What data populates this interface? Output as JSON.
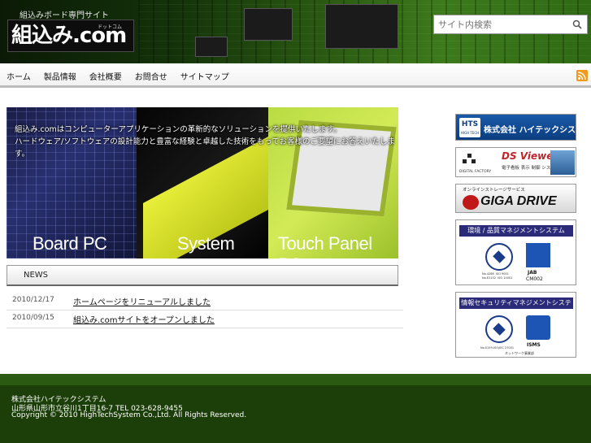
{
  "header": {
    "tagline": "組込みボード専門サイト",
    "logo_text": "組込み.com",
    "logo_ruby": "ドットコム"
  },
  "search": {
    "value": "",
    "placeholder": "サイト内検索"
  },
  "nav": {
    "items": [
      "ホーム",
      "製品情報",
      "会社概要",
      "お問合せ",
      "サイトマップ"
    ]
  },
  "hero": {
    "copy_line1": "組込み.comはコンピューターアプリケーションの革新的なソリューションを提供いたします。",
    "copy_line2": "ハードウェア/ソフトウェアの設計能力と豊富な経験と卓越した技術をもってお客様のご要望にお答えいたします。",
    "products": [
      "Board PC",
      "System",
      "Touch Panel PC"
    ]
  },
  "news": {
    "heading": "NEWS",
    "items": [
      {
        "date": "2010/12/17",
        "title": "ホームページをリニューアルしました"
      },
      {
        "date": "2010/09/15",
        "title": "組込み.comサイトをオープンしました"
      }
    ]
  },
  "banners": {
    "hightech_mark": "HTS",
    "hightech_sub": "HIGH TECH",
    "hightech_name": "株式会社 ハイテックシステム",
    "dsviewer_name": "DS Viewer",
    "dsviewer_prefix": "DIGITAL FACTORY",
    "dsviewer_desc": "電子看板 表示 制御 システム",
    "gigadrive_top": "オンラインストレージサービス",
    "gigadrive_name": "GIGA DRIVE",
    "iso_title": "環境 / 品質マネジメントシステム",
    "iso_badge": "JAB",
    "iso_code": "CM002",
    "iso_numbers": "No.4286  ISO 9001\nNo.E2152  ISO 14001",
    "isms_title": "情報セキュリティマネジメントシステム",
    "isms_badge": "ISMS",
    "isms_numbers": "No.0159-ISO/IEC 27001",
    "isms_dept": "ネットワーク事業部"
  },
  "footer": {
    "company": "株式会社ハイテックシステム",
    "address": "山形県山形市立谷川1丁目16-7  TEL 023-628-9455",
    "copyright": "Copyright © 2010 HighTechSystem Co.,Ltd. All Rights Reserved."
  },
  "colors": {
    "header_green": "#2b5a12",
    "footer_green": "#1c3f0a",
    "rss_orange": "#f29a1f",
    "touchpanel_lime": "#b9dc43",
    "system_yellow": "#e9ef3a"
  }
}
